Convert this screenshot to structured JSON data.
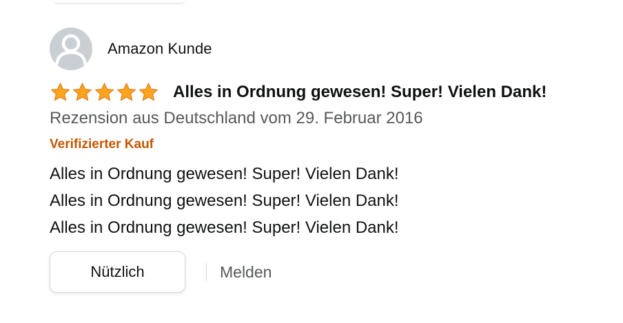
{
  "review": {
    "profile": {
      "name": "Amazon Kunde",
      "avatar_icon": "user-silhouette-icon"
    },
    "rating": {
      "stars": 5,
      "max": 5,
      "star_color": "#ffa41c",
      "star_icon": "star-filled-icon"
    },
    "title": "Alles in Ordnung gewesen! Super! Vielen Dank!",
    "date_line": "Rezension aus Deutschland vom 29. Februar 2016",
    "verified_label": "Verifizierter Kauf",
    "verified_color": "#c45500",
    "body_lines": [
      "Alles in Ordnung gewesen! Super! Vielen Dank!",
      "Alles in Ordnung gewesen! Super! Vielen Dank!",
      "Alles in Ordnung gewesen! Super! Vielen Dank!"
    ],
    "actions": {
      "helpful_label": "Nützlich",
      "report_label": "Melden"
    }
  }
}
